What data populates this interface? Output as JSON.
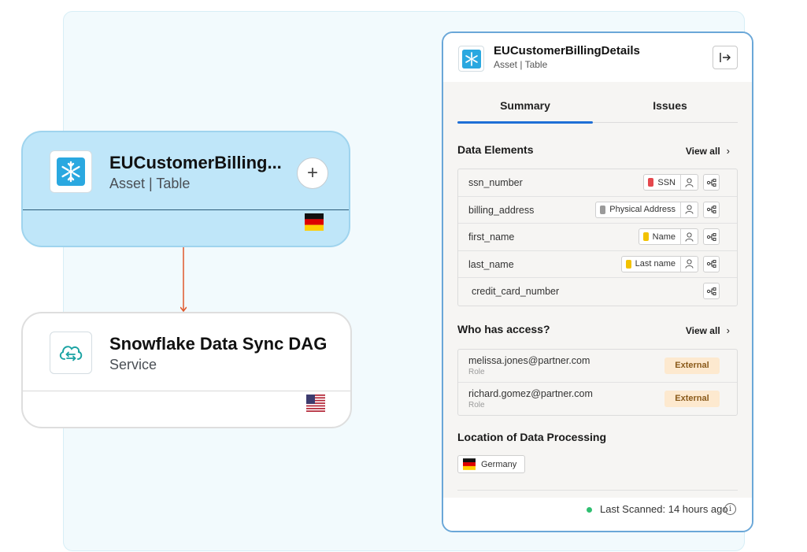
{
  "nodes": {
    "asset": {
      "title": "EUCustomerBilling...",
      "subtitle": "Asset | Table",
      "add_label": "+",
      "flag": "de"
    },
    "service": {
      "title": "Snowflake Data Sync DAG",
      "subtitle": "Service",
      "flag": "us"
    }
  },
  "panel": {
    "title": "EUCustomerBillingDetails",
    "subtitle": "Asset | Table",
    "tabs": [
      {
        "label": "Summary",
        "active": true
      },
      {
        "label": "Issues",
        "active": false
      }
    ],
    "data_elements": {
      "title": "Data Elements",
      "view_all": "View all",
      "rows": [
        {
          "name": "ssn_number",
          "tag": "SSN",
          "tag_color": "#e5484d",
          "has_person": true
        },
        {
          "name": "billing_address",
          "tag": "Physical Address",
          "tag_color": "#9a9a9a",
          "has_person": true
        },
        {
          "name": "first_name",
          "tag": "Name",
          "tag_color": "#f2c200",
          "has_person": true
        },
        {
          "name": "last_name",
          "tag": "Last name",
          "tag_color": "#f2c200",
          "has_person": true
        },
        {
          "name": "credit_card_number",
          "tag": "",
          "tag_color": "",
          "has_person": false
        }
      ]
    },
    "access": {
      "title": "Who has access?",
      "view_all": "View all",
      "rows": [
        {
          "email": "melissa.jones@partner.com",
          "role": "Role",
          "badge": "External"
        },
        {
          "email": "richard.gomez@partner.com",
          "role": "Role",
          "badge": "External"
        }
      ]
    },
    "location": {
      "title": "Location of Data Processing",
      "country": "Germany"
    },
    "footer": {
      "last_scanned": "Last Scanned: 14 hours ago",
      "info": "i"
    }
  },
  "colors": {
    "accent": "#1f6fd6",
    "asset_bg": "#bfe6f9",
    "edge": "#e0582b",
    "status_ok": "#2fbf71",
    "external_badge": "#fde9cf"
  },
  "icons": {
    "asset": "snowflake-icon",
    "service": "cloud-sync-icon",
    "collapse": "collapse-panel-icon",
    "lineage": "lineage-icon",
    "person": "person-icon"
  }
}
